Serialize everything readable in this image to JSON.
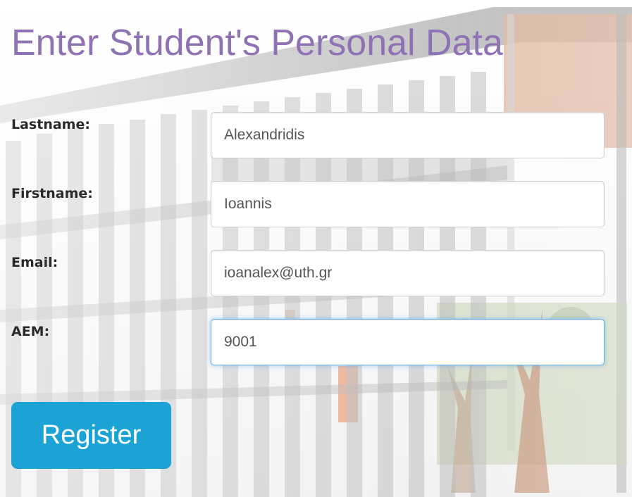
{
  "form": {
    "title": "Enter Student's Personal Data",
    "fields": [
      {
        "label": "Lastname:",
        "value": "Alexandridis"
      },
      {
        "label": "Firstname:",
        "value": "Ioannis"
      },
      {
        "label": "Email:",
        "value": "ioanalex@uth.gr"
      },
      {
        "label": "AEM:",
        "value": "9001"
      }
    ],
    "submit_label": "Register"
  },
  "colors": {
    "title": "#8e72b4",
    "button": "#1aa3d4",
    "focus_ring": "#66afe9"
  },
  "background": {
    "icon": "building-facade-photo"
  }
}
